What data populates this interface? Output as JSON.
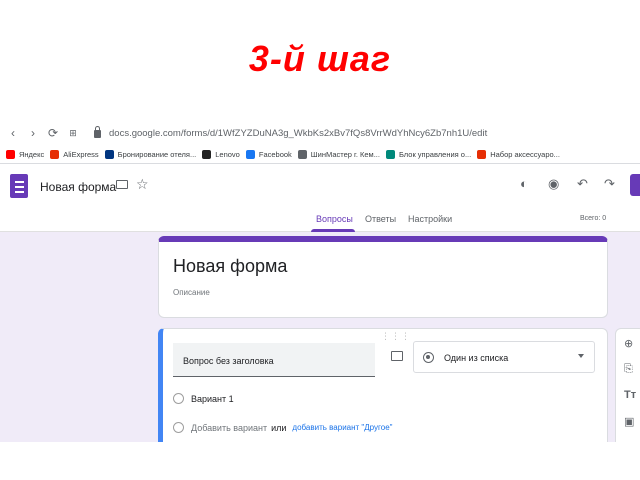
{
  "slide": {
    "title": "3-й шаг"
  },
  "browser": {
    "url": "docs.google.com/forms/d/1WfZYZDuNA3g_WkbKs2xBv7fQs8VrrWdYhNcy6Zb7nh1U/edit",
    "bookmarks": [
      {
        "label": "Яндекс",
        "color": "#ff0000"
      },
      {
        "label": "AliExpress",
        "color": "#e62e04"
      },
      {
        "label": "Бронирование отеля...",
        "color": "#003580"
      },
      {
        "label": "Lenovo",
        "color": "#222222"
      },
      {
        "label": "Facebook",
        "color": "#1877f2"
      },
      {
        "label": "ШинМастер г. Кем...",
        "color": "#5f6368"
      },
      {
        "label": "Блок управления о...",
        "color": "#00897b"
      },
      {
        "label": "Набор аксессуаро...",
        "color": "#e62e04"
      }
    ]
  },
  "form_header": {
    "name": "Новая форма"
  },
  "tabs": {
    "questions": "Вопросы",
    "answers": "Ответы",
    "settings": "Настройки",
    "total": "Всего: 0"
  },
  "title_card": {
    "title": "Новая форма",
    "description": "Описание"
  },
  "question": {
    "title": "Вопрос без заголовка",
    "type": "Один из списка",
    "option1": "Вариант 1",
    "add_option": "Добавить вариант",
    "or": "или",
    "add_other": "добавить вариант \"Другое\""
  },
  "icons": {
    "back": "back-arrow-icon",
    "forward": "forward-arrow-icon",
    "reload": "reload-icon",
    "palette": "palette-icon",
    "preview": "eye-icon",
    "undo": "undo-icon",
    "redo": "redo-icon",
    "add_question": "add-circle-icon",
    "import": "import-icon",
    "title_text": "text-title-icon",
    "image": "image-icon"
  },
  "colors": {
    "accent": "#673ab7",
    "active_border": "#4285f4",
    "slide_title": "#ff0000",
    "link": "#1a73e8"
  }
}
